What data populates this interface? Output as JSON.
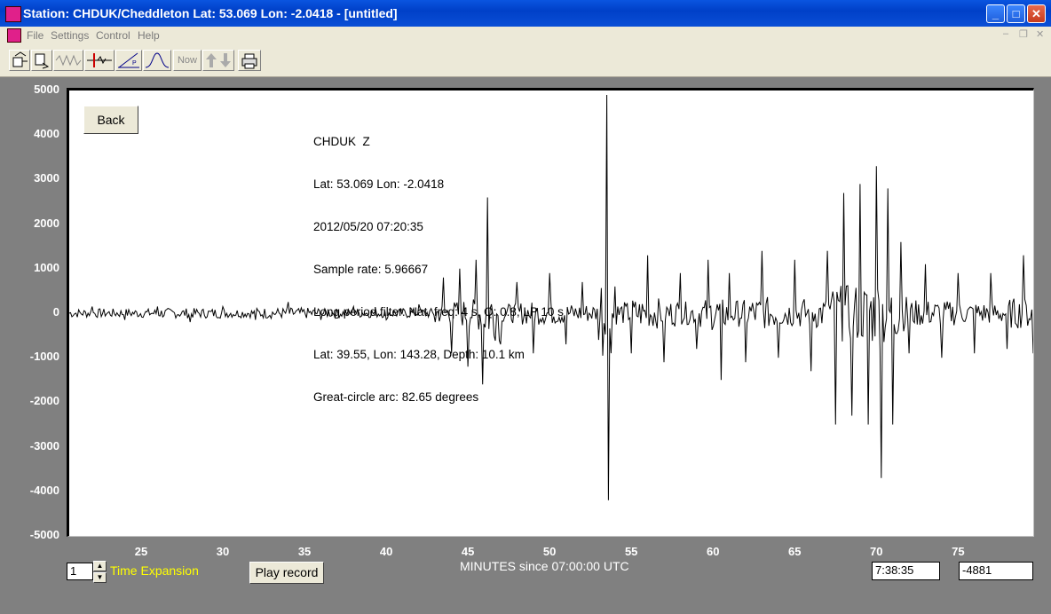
{
  "window": {
    "title": "Station: CHDUK/Cheddleton Lat: 53.069 Lon: -2.0418 - [untitled]"
  },
  "menu": {
    "items": [
      "File",
      "Settings",
      "Control",
      "Help"
    ]
  },
  "toolbar": {
    "now_label": "Now"
  },
  "plot": {
    "back_label": "Back",
    "info_lines": [
      "CHDUK  Z",
      "Lat: 53.069 Lon: -2.0418",
      "2012/05/20 07:20:35",
      "Sample rate: 5.96667",
      "Long period filter. Nat. freq: 4 s, Q: 0.8, LP 10 s",
      "Lat: 39.55, Lon: 143.28, Depth: 10.1 km",
      "Great-circle arc: 82.65 degrees"
    ]
  },
  "chart_data": {
    "type": "line",
    "xlabel": "MINUTES since 07:00:00 UTC",
    "ylabel": "",
    "xlim": [
      20.6,
      79.6
    ],
    "ylim": [
      -5000,
      5000
    ],
    "yticks": [
      "5000",
      "4000",
      "3000",
      "2000",
      "1000",
      "0",
      "-1000",
      "-2000",
      "-3000",
      "-4000",
      "-5000"
    ],
    "xticks": [
      "25",
      "30",
      "35",
      "40",
      "45",
      "50",
      "55",
      "60",
      "65",
      "70",
      "75"
    ],
    "series": [
      {
        "x": [
          20.6,
          22,
          24,
          26,
          28,
          30,
          32,
          34,
          36,
          38,
          40,
          42,
          43,
          43.5,
          44,
          44.5,
          45,
          45.5,
          45.9,
          46.2,
          47,
          48,
          49,
          50,
          51,
          52,
          53,
          53.5,
          53.6,
          54,
          55,
          56,
          57,
          58,
          59,
          59.7,
          60.5,
          61,
          62,
          63,
          64,
          65,
          66,
          67,
          67.5,
          68,
          68.5,
          69,
          69.5,
          70,
          70.3,
          70.7,
          71,
          71.5,
          72,
          73,
          74,
          75,
          76,
          77,
          78,
          79,
          79.6
        ],
        "y": [
          0,
          150,
          -150,
          150,
          -200,
          150,
          -150,
          250,
          -150,
          150,
          -150,
          200,
          -200,
          800,
          -900,
          1000,
          -1200,
          1200,
          -1600,
          2600,
          -700,
          700,
          -900,
          900,
          -700,
          700,
          -600,
          4900,
          -4200,
          600,
          -900,
          1300,
          -1100,
          900,
          -800,
          1200,
          -1500,
          900,
          -1100,
          1400,
          -1000,
          1200,
          -1300,
          1400,
          -2500,
          2700,
          -2300,
          2900,
          -2500,
          3300,
          -3700,
          2800,
          -2500,
          1600,
          -900,
          1100,
          -1000,
          900,
          -900,
          900,
          -800,
          1300,
          -900
        ]
      }
    ]
  },
  "bottom": {
    "time_expansion_value": "1",
    "time_expansion_label": "Time Expansion",
    "play_label": "Play record",
    "time_readout": "7:38:35",
    "value_readout": "-4881"
  }
}
